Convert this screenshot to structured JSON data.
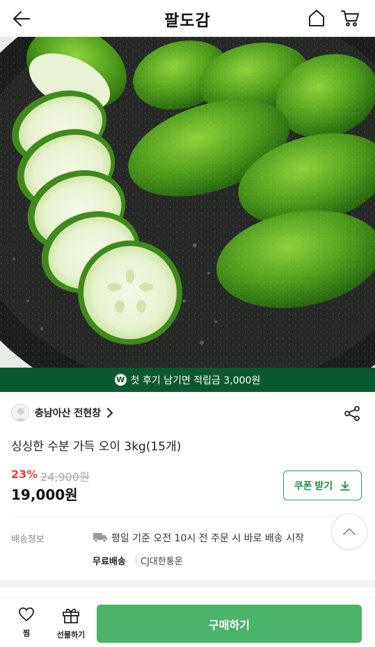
{
  "header": {
    "title": "팔도감",
    "back_icon": "arrow-left-icon",
    "home_icon": "home-icon",
    "cart_icon": "cart-icon"
  },
  "hero": {
    "image_icon": "product-photo-cucumbers"
  },
  "banner": {
    "icon_text": "W",
    "text": "첫 후기 남기면 적립금 3,000원",
    "color": "#0b5a2f"
  },
  "seller": {
    "name": "충남아산 전현창"
  },
  "product": {
    "name": "싱싱한 수분 가득 오이 3kg(15개)",
    "discount": "23%",
    "original_price": "24,900원",
    "price": "19,000원"
  },
  "coupon": {
    "label": "쿠폰 받기",
    "color": "#1f8f48"
  },
  "shipping": {
    "label": "배송정보",
    "info": "평일 기준 오전 10시 전 주문 시 바로 배송 시작",
    "free": "무료배송",
    "courier": "CJ대한통운"
  },
  "bottom": {
    "wish_label": "찜",
    "gift_label": "선물하기",
    "buy_label": "구매하기",
    "buy_color": "#4bb36a"
  }
}
